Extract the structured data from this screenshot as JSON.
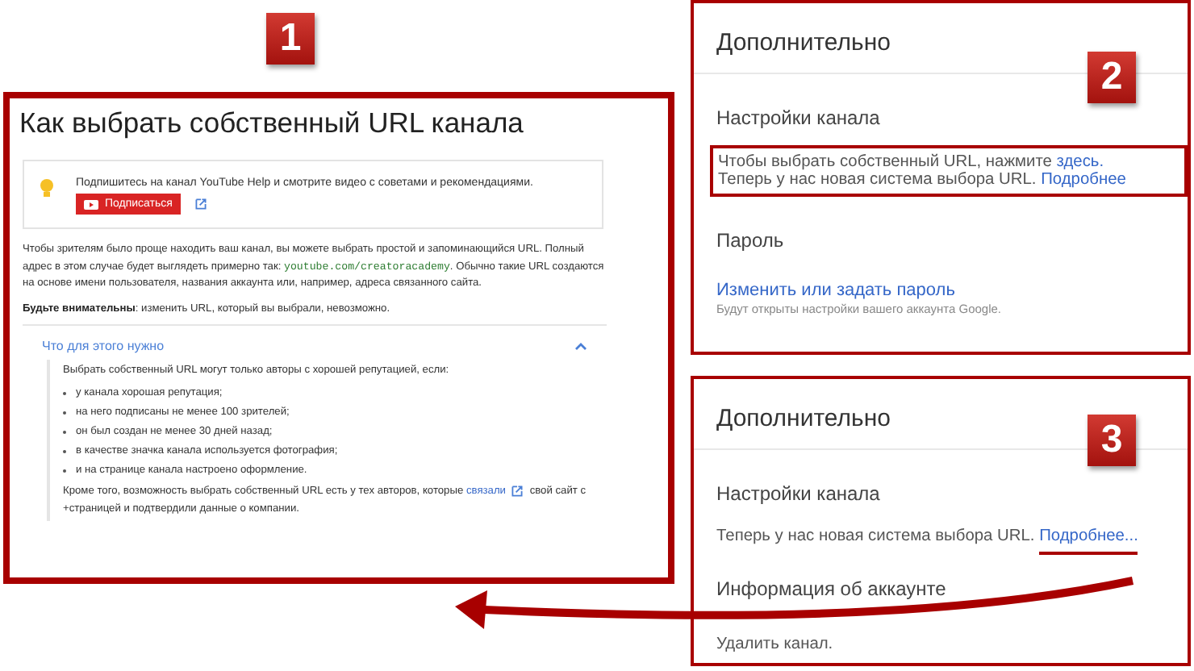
{
  "help_article": {
    "badge": "1",
    "title": "Как выбрать собственный URL канала",
    "tip": {
      "text": "Подпишитесь на канал YouTube Help и смотрите видео с советами и рекомендациями.",
      "button": "Подписаться"
    },
    "paragraph": [
      {
        "kind": "text",
        "text": "Чтобы зрителям было проще находить ваш канал, вы можете выбрать простой и запоминающийся URL. Полный адрес в этом случае будет выглядеть примерно так: "
      },
      {
        "kind": "code",
        "text": "youtube.com/creatoracademy"
      },
      {
        "kind": "text",
        "text": ". Обычно такие URL создаются на основе имени пользователя, названия аккаунта или, например, адреса связанного сайта."
      }
    ],
    "warning": "**Будьте внимательны**: изменить URL, который вы выбрали, невозможно.",
    "accordion": {
      "title": "Что для этого нужно",
      "expanded": true,
      "intro": "Выбрать собственный URL могут только авторы с хорошей репутацией, если:",
      "bullets": [
        "у канала хорошая репутация;",
        "на него подписаны не менее 100 зрителей;",
        "он был создан не менее 30 дней назад;",
        "в качестве значка канала используется фотография;",
        "и на странице канала настроено оформление."
      ],
      "outro": [
        {
          "kind": "text",
          "text": "Кроме того, возможность выбрать собственный URL есть у тех авторов, которые "
        },
        {
          "kind": "link",
          "text": "связали"
        },
        {
          "kind": "text",
          "text": " свой сайт с +страницей и подтвердили данные о компании."
        }
      ]
    }
  },
  "settings_old": {
    "badge": "2",
    "heading": "Дополнительно",
    "section": "Настройки канала",
    "note": [
      [
        {
          "kind": "text",
          "text": "Чтобы выбрать собственный URL, нажмите "
        },
        {
          "kind": "link",
          "text": "здесь."
        }
      ],
      [
        {
          "kind": "text",
          "text": "Теперь у нас новая система выбора URL. "
        },
        {
          "kind": "link",
          "text": "Подробнее"
        }
      ]
    ],
    "password_heading": "Пароль",
    "password_link": "Изменить или задать пароль",
    "password_hint": "Будут открыты настройки вашего аккаунта Google."
  },
  "settings_new": {
    "badge": "3",
    "heading": "Дополнительно",
    "section": "Настройки канала",
    "note": [
      {
        "kind": "text",
        "text": "Теперь у нас новая система выбора URL. "
      },
      {
        "kind": "link",
        "text": "Подробнее..."
      }
    ],
    "account_heading": "Информация об аккаунте",
    "account_text": "Удалить канал."
  }
}
